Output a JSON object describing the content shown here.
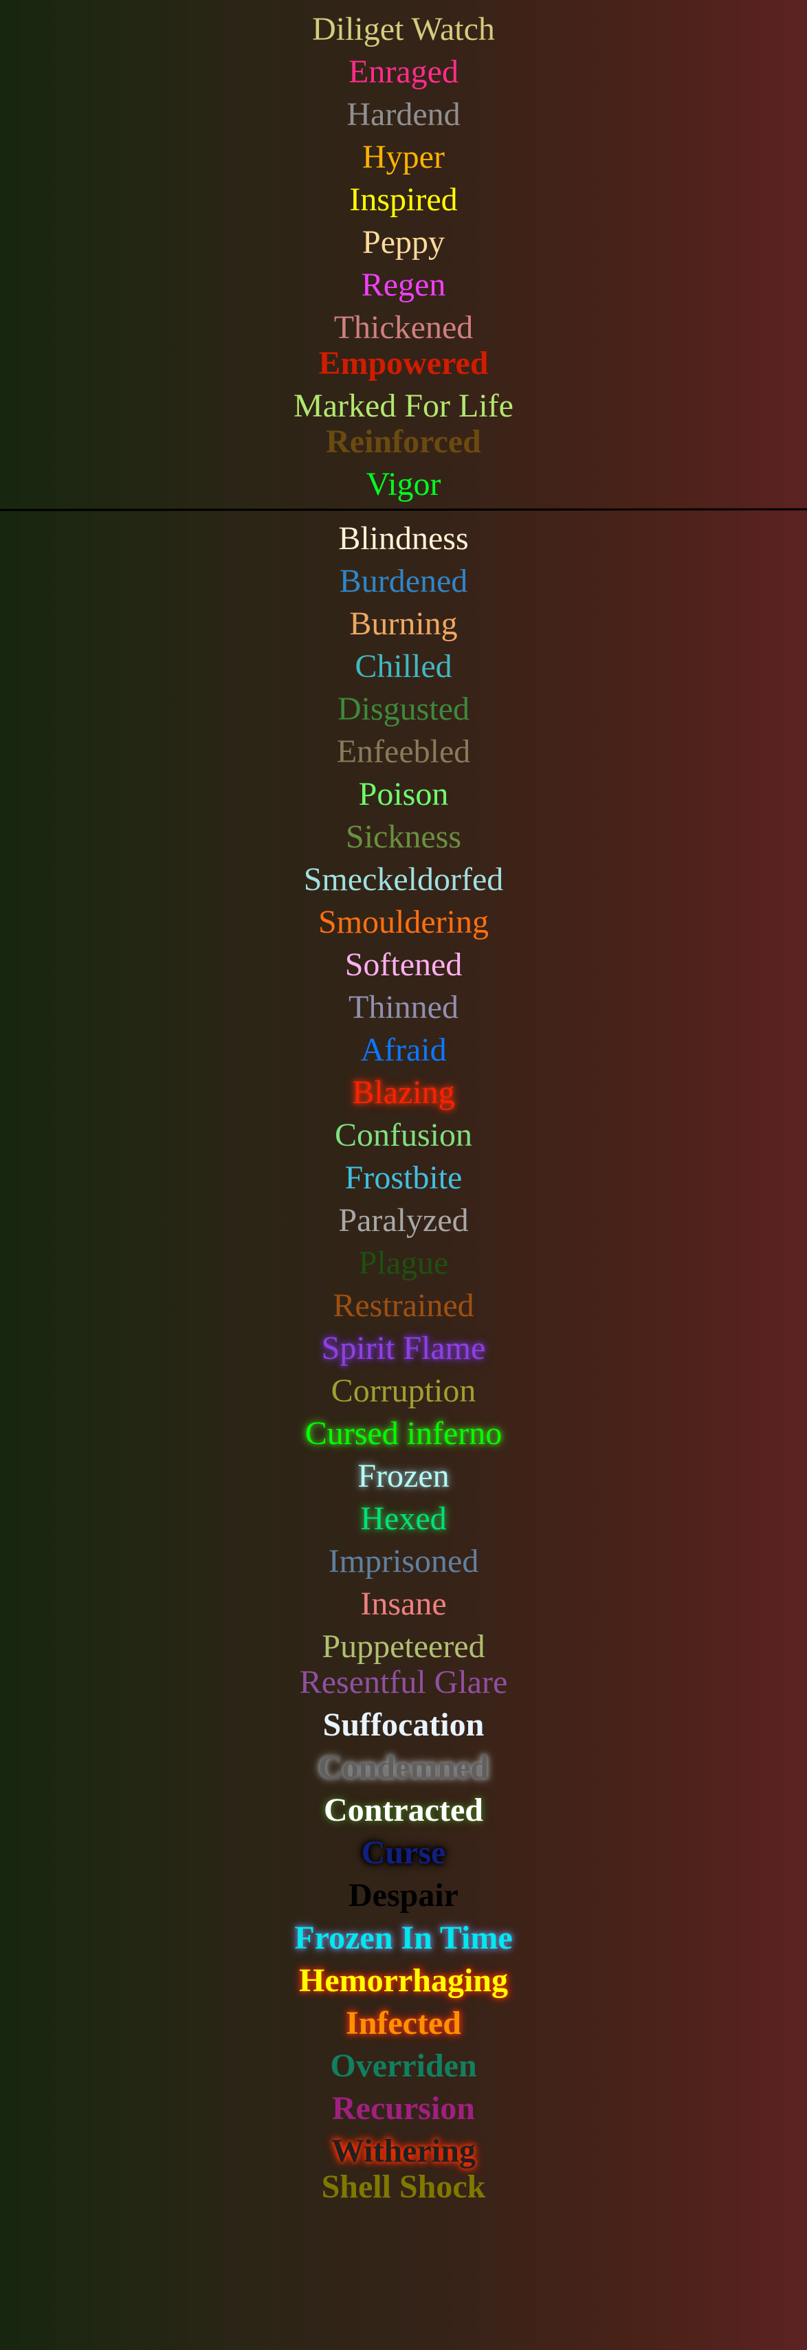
{
  "buffs": [
    {
      "label": "Diliget Watch",
      "color": "#d4cc7e"
    },
    {
      "label": "Enraged",
      "color": "#ff2d8a"
    },
    {
      "label": "Hardend",
      "color": "#909090"
    },
    {
      "label": "Hyper",
      "color": "#ffb300"
    },
    {
      "label": "Inspired",
      "color": "#ffff00"
    },
    {
      "label": "Peppy",
      "color": "#ffdb9c"
    },
    {
      "label": "Regen",
      "color": "#f040f8"
    },
    {
      "label": "Thickened",
      "color": "#d08080"
    },
    {
      "label": "Empowered",
      "color": "#d01c00"
    },
    {
      "label": "Marked For Life",
      "color": "#b2e870"
    },
    {
      "label": "Reinforced",
      "color": "#6b4a10"
    },
    {
      "label": "Vigor",
      "color": "#00ff20"
    }
  ],
  "debuffs": [
    {
      "label": "Blindness",
      "color": "#fff3d6"
    },
    {
      "label": "Burdened",
      "color": "#2f86c8"
    },
    {
      "label": "Burning",
      "color": "#f0a860"
    },
    {
      "label": "Chilled",
      "color": "#40b8c0"
    },
    {
      "label": "Disgusted",
      "color": "#3e8a3a"
    },
    {
      "label": "Enfeebled",
      "color": "#8a7a5a"
    },
    {
      "label": "Poison",
      "color": "#6dff6d"
    },
    {
      "label": "Sickness",
      "color": "#6a9040"
    },
    {
      "label": "Smeckeldorfed",
      "color": "#a0e0e0"
    },
    {
      "label": "Smouldering",
      "color": "#ff7010"
    },
    {
      "label": "Softened",
      "color": "#ffb0f0"
    },
    {
      "label": "Thinned",
      "color": "#9090b0"
    },
    {
      "label": "Afraid",
      "color": "#0a78ff"
    },
    {
      "label": "Blazing",
      "color": "#ff2000",
      "glow": "#c03010"
    },
    {
      "label": "Confusion",
      "color": "#80e080"
    },
    {
      "label": "Frostbite",
      "color": "#40c0e0"
    },
    {
      "label": "Paralyzed",
      "color": "#a8a8a8"
    },
    {
      "label": "Plague",
      "color": "#1e5010"
    },
    {
      "label": "Restrained",
      "color": "#a05010"
    },
    {
      "label": "Spirit Flame",
      "color": "#9040e0",
      "glow": "#6030a0"
    },
    {
      "label": "Corruption",
      "color": "#a0a030"
    },
    {
      "label": "Cursed inferno",
      "color": "#00ff00",
      "glow": "#40a020"
    },
    {
      "label": "Frozen",
      "color": "#b0fff8",
      "glow": "#708080"
    },
    {
      "label": "Hexed",
      "color": "#00e080",
      "glow": "#308030"
    },
    {
      "label": "Imprisoned",
      "color": "#6080a0"
    },
    {
      "label": "Insane",
      "color": "#f08080"
    },
    {
      "label": "Puppeteered",
      "color": "#b0c070"
    },
    {
      "label": "Resentful Glare",
      "color": "#9050a0"
    },
    {
      "label": "Suffocation",
      "color": "#e8f4ff"
    },
    {
      "label": "Condemned",
      "color": "#606060",
      "glow": "#909090"
    },
    {
      "label": "Contracted",
      "color": "#ffffff",
      "glow": "#406020"
    },
    {
      "label": "Curse",
      "color": "#102080",
      "glow": "#000000"
    },
    {
      "label": "Despair",
      "color": "#000000"
    },
    {
      "label": "Frozen In Time",
      "color": "#00e8f0",
      "glow": "#6070a0"
    },
    {
      "label": "Hemorrhaging",
      "color": "#ffff00",
      "glow": "#d03000"
    },
    {
      "label": "Infected",
      "color": "#ff9000",
      "glow": "#c03010"
    },
    {
      "label": "Overriden",
      "color": "#108060"
    },
    {
      "label": "Recursion",
      "color": "#a02080"
    },
    {
      "label": "Withering",
      "color": "#202020",
      "glow": "#ff3000"
    },
    {
      "label": "Shell Shock",
      "color": "#807800"
    }
  ]
}
